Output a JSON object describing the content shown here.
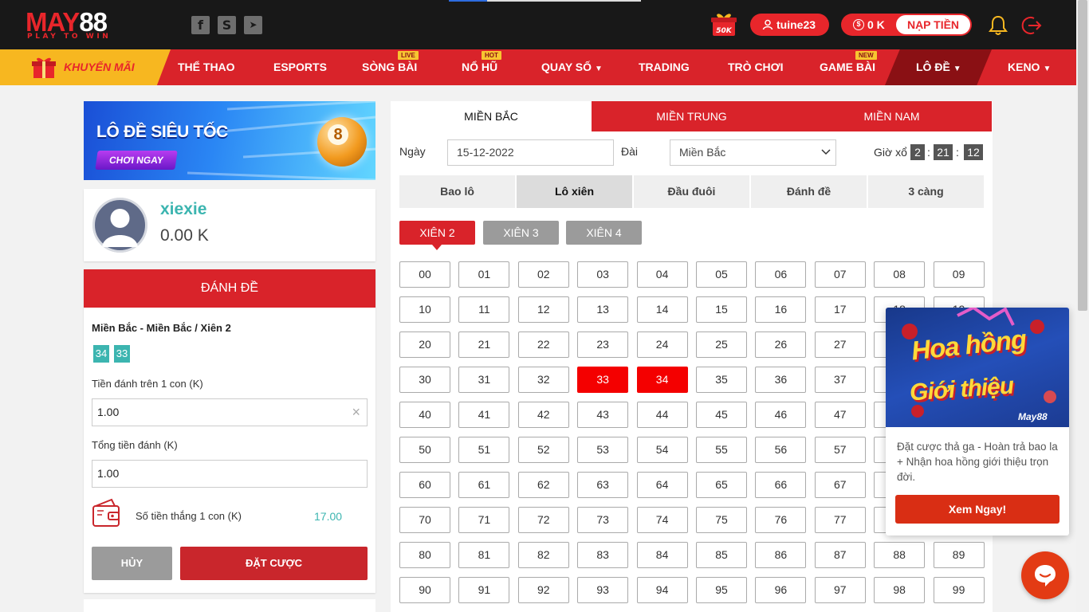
{
  "header": {
    "logo_main_red": "MAY",
    "logo_main_white": "88",
    "logo_sub": "PLAY TO WIN",
    "social": [
      {
        "name": "facebook-icon",
        "glyph": "f"
      },
      {
        "name": "skype-icon",
        "glyph": "S"
      },
      {
        "name": "telegram-icon",
        "glyph": "➤"
      }
    ],
    "gift_badge": "50K",
    "username": "tuine23",
    "balance": "0 K",
    "deposit_label": "NẠP TIỀN"
  },
  "nav": {
    "promo": "KHUYẾN MÃI",
    "items": [
      {
        "label": "THỂ THAO",
        "tag": ""
      },
      {
        "label": "ESPORTS",
        "tag": ""
      },
      {
        "label": "SÒNG BÀI",
        "tag": "LIVE"
      },
      {
        "label": "NỔ HŨ",
        "tag": "HOT"
      },
      {
        "label": "QUAY SỐ",
        "tag": ""
      },
      {
        "label": "TRADING",
        "tag": ""
      },
      {
        "label": "TRÒ CHƠI",
        "tag": ""
      },
      {
        "label": "GAME BÀI",
        "tag": "NEW"
      },
      {
        "label": "LÔ ĐỀ",
        "tag": ""
      },
      {
        "label": "KENO",
        "tag": ""
      }
    ]
  },
  "banner": {
    "title": "LÔ ĐỀ SIÊU TỐC",
    "cta": "CHƠI NGAY",
    "ball": "8"
  },
  "profile": {
    "name": "xiexie",
    "balance": "0.00 K"
  },
  "bet_panel": {
    "header": "ĐÁNH ĐỀ",
    "title": "Miền Bắc - Miền Bắc / Xiên 2",
    "selected": [
      "34",
      "33"
    ],
    "stake_label": "Tiền đánh trên 1 con (K)",
    "stake_value": "1.00",
    "clear_glyph": "×",
    "total_label": "Tổng tiền đánh (K)",
    "total_value": "1.00",
    "win_label": "Số tiền thắng 1 con (K)",
    "win_value": "17.00",
    "cancel": "HỦY",
    "submit": "ĐẶT CƯỢC"
  },
  "region_tabs": [
    "MIỀN BẮC",
    "MIỀN TRUNG",
    "MIỀN NAM"
  ],
  "filters": {
    "date_label": "Ngày",
    "date_value": "15-12-2022",
    "station_label": "Đài",
    "station_value": "Miền Bắc",
    "time_label": "Giờ xổ",
    "time": [
      "2",
      "21",
      "12"
    ]
  },
  "game_tabs": [
    "Bao lô",
    "Lô xiên",
    "Đầu đuôi",
    "Đánh đề",
    "3 càng"
  ],
  "xien_tabs": [
    "XIÊN 2",
    "XIÊN 3",
    "XIÊN 4"
  ],
  "selected_numbers": [
    "33",
    "34"
  ],
  "popup": {
    "title1": "Hoa hồng",
    "title2": "Giới thiệu",
    "brand": "May88",
    "desc": "Đặt cược thả ga - Hoàn trả bao la + Nhận hoa hồng giới thiệu trọn đời.",
    "cta": "Xem Ngay!"
  },
  "colors": {
    "brand_red": "#d9232a",
    "teal": "#3cb5b0",
    "selected_red": "#f40000",
    "gold": "#f7b720"
  }
}
